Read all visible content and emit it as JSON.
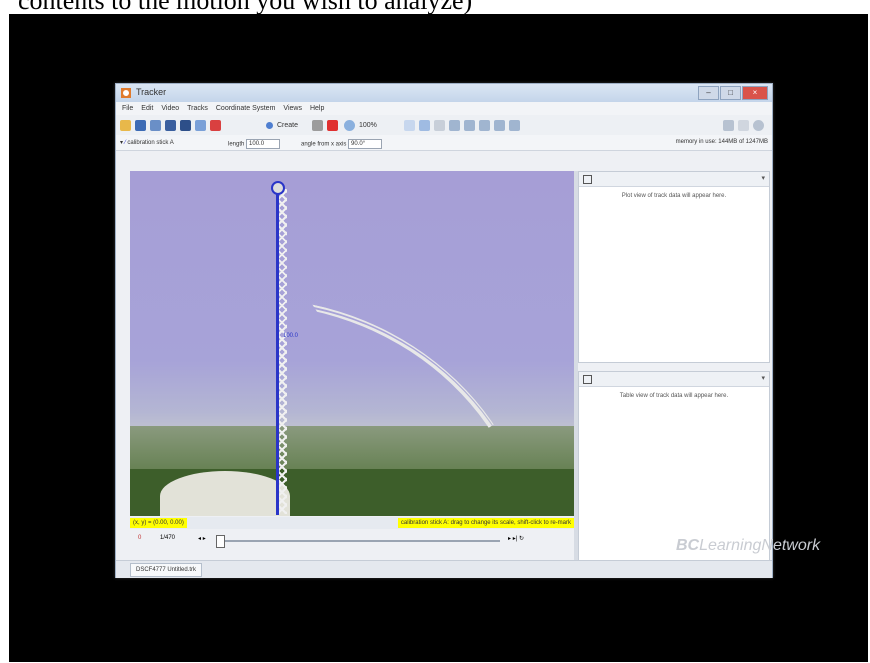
{
  "caption": "contents to the motion you wish to analyze)",
  "window": {
    "title": "Tracker",
    "controls": [
      "–",
      "□",
      "×"
    ]
  },
  "menu": [
    "File",
    "Edit",
    "Video",
    "Tracks",
    "Coordinate System",
    "Views",
    "Help"
  ],
  "toolbar": {
    "create_label": "Create",
    "zoom_label": "100%"
  },
  "trackbar": {
    "track_name": "calibration stick A",
    "length_label": "length",
    "length_value": "100.0",
    "angle_label": "angle from x axis",
    "angle_value": "90.0°",
    "memory_label": "memory in use: 144MB of 1247MB"
  },
  "video": {
    "calib_label": "100.0"
  },
  "status": {
    "coords": "(x, y) = (0.00, 0.00)",
    "hint": "calibration stick A: drag to change its scale, shift-click to re-mark"
  },
  "player": {
    "frame_value": "0",
    "step_value": "1/470"
  },
  "tab": {
    "label": "DSCF4777 Untitled.trk"
  },
  "panels": {
    "plot_message": "Plot view of track data will appear here.",
    "table_message": "Table view of track data will appear here."
  },
  "watermark": {
    "prefix": "BC",
    "rest": "LearningNetwork"
  }
}
